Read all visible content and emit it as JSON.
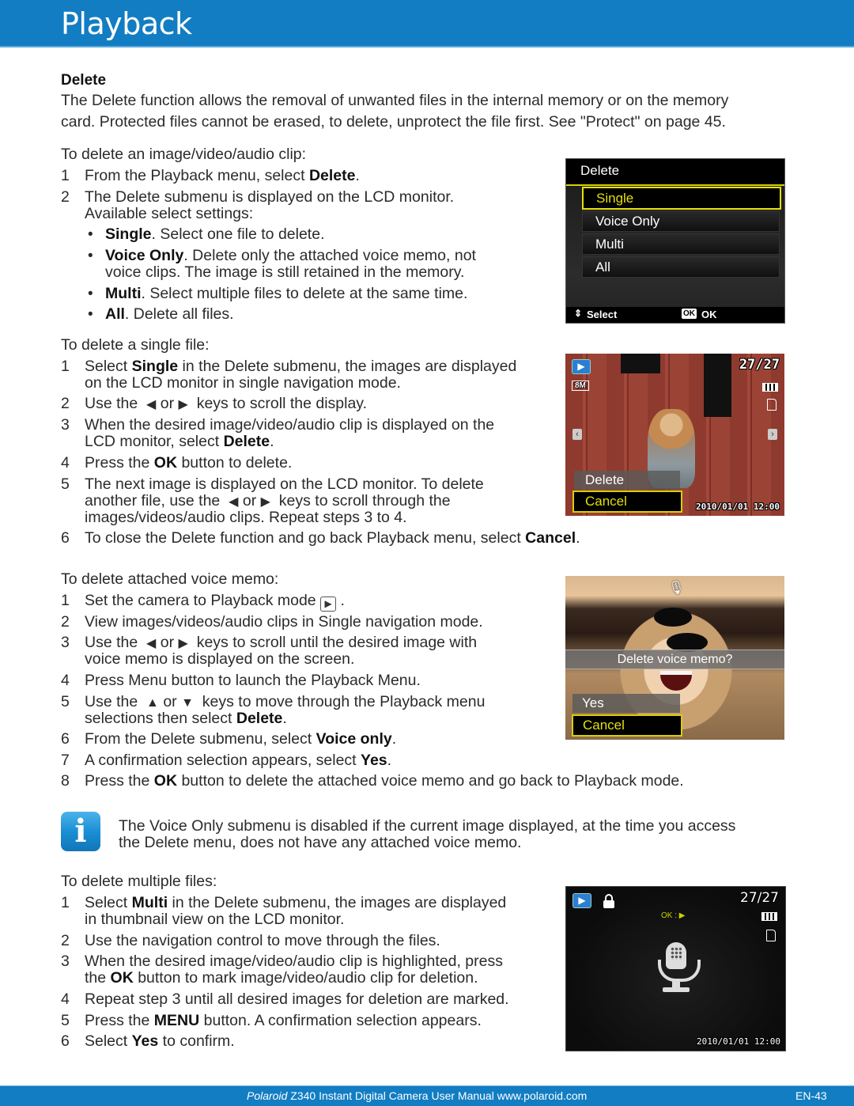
{
  "header": {
    "title": "Playback"
  },
  "section": {
    "heading": "Delete",
    "intro_line1": "The Delete function allows the removal of unwanted files in the internal memory or on the memory",
    "intro_line2": "card. Protected files cannot be erased, to delete, unprotect the file first. See \"Protect\" on page 45."
  },
  "clip": {
    "lead": "To delete an image/video/audio clip:",
    "step1_pre": "From the Playback menu, select ",
    "step1_bold": "Delete",
    "step2_line1": "The Delete submenu is displayed on the LCD monitor.",
    "step2_line2": "Available select settings:",
    "bullets": [
      {
        "bold": "Single",
        "text": ". Select one file to delete."
      },
      {
        "bold": "Voice Only",
        "text": ". Delete only the attached voice memo, not",
        "text2": "voice clips. The image is still retained in the memory."
      },
      {
        "bold": "Multi",
        "text": ". Select multiple files to delete at the same time."
      },
      {
        "bold": "All",
        "text": ". Delete all files."
      }
    ]
  },
  "single": {
    "lead": "To delete a single file:",
    "s1_pre": "Select ",
    "s1_bold": "Single",
    "s1_post": " in the Delete submenu, the images are displayed",
    "s1_line2": "on the LCD monitor in single navigation mode.",
    "s2_pre": "Use the",
    "s2_or": "or",
    "s2_post": "keys to scroll the display.",
    "s3_line1": "When the desired image/video/audio clip is displayed on the",
    "s3_pre2": "LCD monitor, select ",
    "s3_bold": "Delete",
    "s4_pre": "Press the ",
    "s4_bold": "OK",
    "s4_post": " button to delete.",
    "s5_line1": "The next image is displayed on the LCD monitor. To delete",
    "s5_pre2": "another file, use the",
    "s5_or": "or",
    "s5_post2": "keys to scroll through the",
    "s5_line3": "images/videos/audio clips. Repeat steps 3 to 4.",
    "s6_pre": "To close the Delete function and go back Playback menu, select ",
    "s6_bold": "Cancel"
  },
  "voice": {
    "lead": "To delete attached voice memo:",
    "v1": "Set the camera to Playback mode",
    "v2": "View images/videos/audio clips in Single navigation mode.",
    "v3_pre": "Use the",
    "v3_or": "or",
    "v3_post": "keys to scroll until the desired image with",
    "v3_line2": "voice memo is displayed on the screen.",
    "v4": "Press Menu button to launch the Playback Menu.",
    "v5_pre": "Use the",
    "v5_or": "or",
    "v5_post": "keys to move through the Playback menu",
    "v5_pre2": "selections then select ",
    "v5_bold": "Delete",
    "v6_pre": "From the Delete submenu, select ",
    "v6_bold": "Voice only",
    "v7_pre": "A confirmation selection appears, select ",
    "v7_bold": "Yes",
    "v8_pre": "Press the ",
    "v8_bold": "OK",
    "v8_post": " button to delete the attached voice memo and go back to Playback mode."
  },
  "note": {
    "line1": "The Voice Only submenu is disabled if the current image displayed, at the time you access",
    "line2": "the Delete menu, does not have any attached voice memo."
  },
  "multi": {
    "lead": "To delete multiple files:",
    "m1_pre": "Select ",
    "m1_bold": "Multi",
    "m1_post": " in the Delete submenu, the images are displayed",
    "m1_line2": "in thumbnail view on the LCD monitor.",
    "m2": "Use the navigation control to move through the files.",
    "m3_line1": "When the desired image/video/audio clip is highlighted, press",
    "m3_pre2": "the ",
    "m3_bold": "OK",
    "m3_post2": " button to mark image/video/audio clip for deletion.",
    "m4": "Repeat step 3 until all desired images for deletion are marked.",
    "m5_pre": "Press the ",
    "m5_bold": "MENU",
    "m5_post": " button. A confirmation selection appears.",
    "m6_pre": "Select ",
    "m6_bold": "Yes",
    "m6_post": " to confirm."
  },
  "screens": {
    "delete_menu": {
      "title": "Delete",
      "options": [
        "Single",
        "Voice Only",
        "Multi",
        "All"
      ],
      "selected": "Single",
      "hint_select": "Select",
      "hint_ok_badge": "OK",
      "hint_ok": "OK"
    },
    "single_view": {
      "counter": "27/27",
      "resolution": "8M",
      "options": [
        "Delete",
        "Cancel"
      ],
      "selected": "Cancel",
      "datetime": "2010/01/01  12:00"
    },
    "voice_memo": {
      "prompt": "Delete voice memo?",
      "options": [
        "Yes",
        "Cancel"
      ],
      "selected": "Cancel"
    },
    "multi_view": {
      "counter": "27/27",
      "ok_hint": "OK : ▶",
      "datetime": "2010/01/01  12:00"
    }
  },
  "footer": {
    "brand": "Polaroid",
    "text": " Z340 Instant Digital Camera User Manual www.polaroid.com",
    "page": "EN-43"
  },
  "colors": {
    "brand_blue": "#127dc2",
    "lcd_highlight": "#e6df0a"
  }
}
